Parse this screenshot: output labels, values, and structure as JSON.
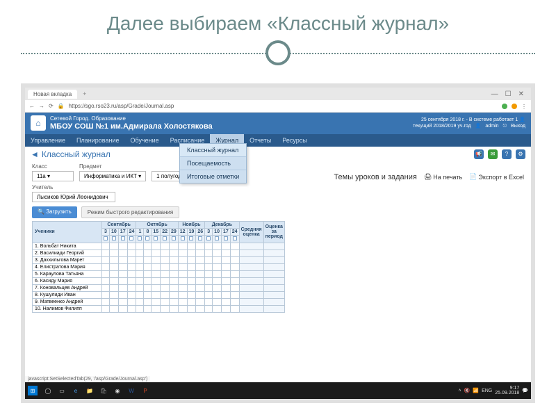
{
  "slide": {
    "title": "Далее выбираем «Классный журнал»"
  },
  "browser": {
    "tab_label": "Новая вкладка",
    "url": "https://sgo.rso23.ru/asp/Grade/Journal.asp",
    "status": "javascript:SetSelectedTab(29, '/asp/Grade/Journal.asp')"
  },
  "header": {
    "line1": "Сетевой Город. Образование",
    "line2": "МБОУ СОШ №1 им.Адмирала Холостякова",
    "status": "25 сентября 2018 г. - В системе работает 1",
    "year": "текущий 2018/2019 уч.год",
    "user": "admin",
    "logout": "Выход"
  },
  "menu": {
    "items": [
      "Управление",
      "Планирование",
      "Обучение",
      "Расписание",
      "Журнал",
      "Отчеты",
      "Ресурсы"
    ],
    "active_index": 4,
    "dropdown": [
      "Классный журнал",
      "Посещаемость",
      "Итоговые отметки"
    ]
  },
  "page": {
    "title": "Классный журнал",
    "section_title": "Темы уроков и задания",
    "print": "На печать",
    "export": "Экспорт в Excel"
  },
  "filters": {
    "class_label": "Класс",
    "class_value": "11а",
    "subject_label": "Предмет",
    "subject_value": "Информатика и ИКТ",
    "period_value": "1 полугодие",
    "teacher_label": "Учитель",
    "teacher_value": "Лысиков Юрий Леонидович",
    "load_btn": "Загрузить",
    "quick_edit": "Режим быстрого редактирования"
  },
  "table": {
    "students_header": "Ученики",
    "months": [
      {
        "name": "Сентябрь",
        "days": [
          "3",
          "10",
          "17",
          "24"
        ]
      },
      {
        "name": "Октябрь",
        "days": [
          "1",
          "8",
          "15",
          "22",
          "29"
        ]
      },
      {
        "name": "Ноябрь",
        "days": [
          "12",
          "19",
          "26"
        ]
      },
      {
        "name": "Декабрь",
        "days": [
          "3",
          "10",
          "17",
          "24"
        ]
      }
    ],
    "avg_header": "Средняя\nоценка",
    "period_header": "Оценка\nза\nпериод",
    "students": [
      "Вольбат Никита",
      "Василиади Георгий",
      "Даххильгова Марет",
      "Елистратова Мария",
      "Караулова Татьяна",
      "Касиду Мария",
      "Коновальцев Андрей",
      "Кушулиди Иван",
      "Матвеенко Андрей",
      "Налимов Филипп"
    ]
  },
  "taskbar": {
    "lang": "ENG",
    "time": "9:17",
    "date": "25.09.2018"
  }
}
